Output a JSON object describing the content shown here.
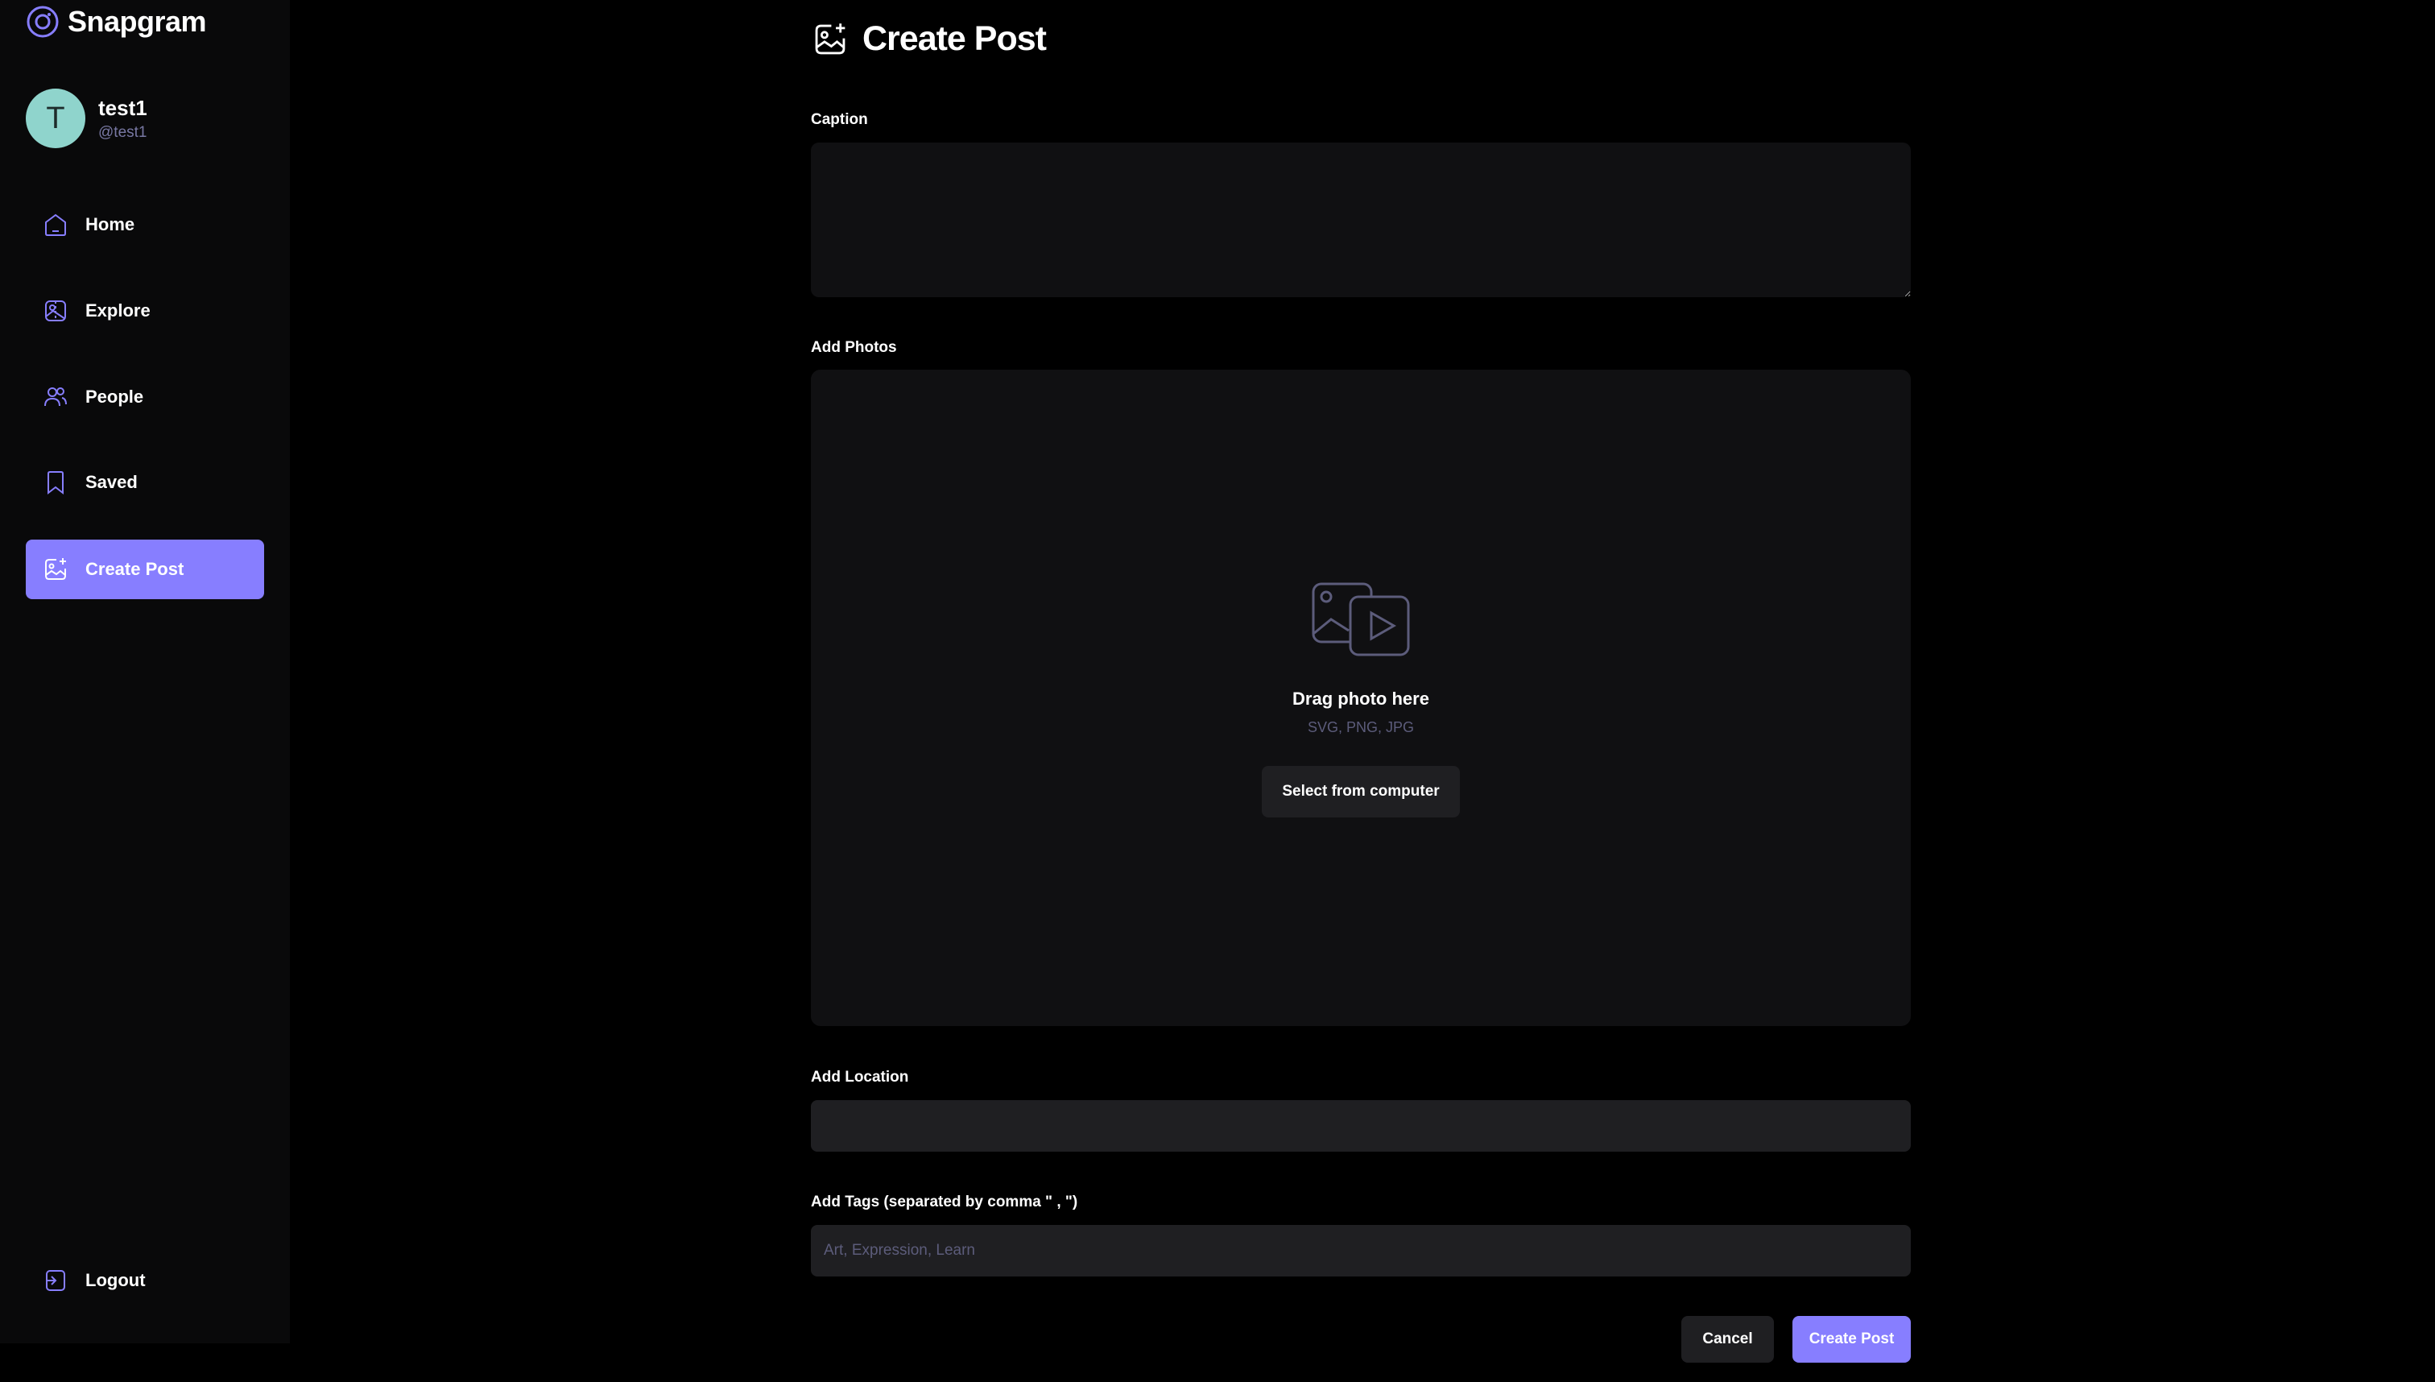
{
  "app": {
    "name": "Snapgram",
    "accent_color": "#877eff"
  },
  "user": {
    "avatar_initial": "T",
    "name": "test1",
    "handle": "@test1"
  },
  "sidebar": {
    "items": [
      {
        "label": "Home",
        "icon": "home-icon"
      },
      {
        "label": "Explore",
        "icon": "explore-icon"
      },
      {
        "label": "People",
        "icon": "people-icon"
      },
      {
        "label": "Saved",
        "icon": "bookmark-icon"
      },
      {
        "label": "Create Post",
        "icon": "gallery-add-icon",
        "active": true
      }
    ],
    "logout_label": "Logout"
  },
  "page": {
    "title": "Create Post"
  },
  "form": {
    "caption_label": "Caption",
    "caption_value": "",
    "photos_label": "Add Photos",
    "dropzone_title": "Drag photo here",
    "dropzone_formats": "SVG, PNG, JPG",
    "dropzone_button": "Select from computer",
    "location_label": "Add Location",
    "location_value": "",
    "tags_label": "Add Tags (separated by comma \" , \")",
    "tags_placeholder": "Art, Expression, Learn",
    "cancel_label": "Cancel",
    "submit_label": "Create Post"
  }
}
